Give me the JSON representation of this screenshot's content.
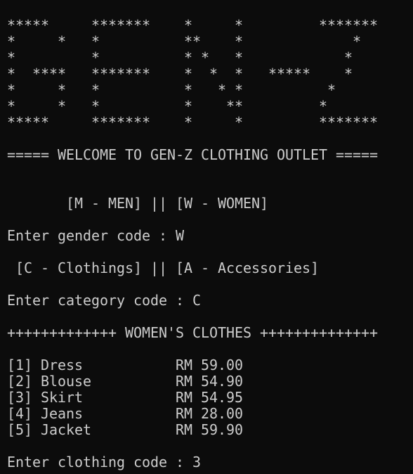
{
  "terminal": {
    "banner": [
      "*****     *******    *     *         *******",
      "*     *   *          **    *             *",
      "*         *          * *   *            *",
      "*  ****   *******    *  *  *   *****    *",
      "*     *   *          *   * *          *",
      "*     *   *          *    **         *",
      "*****     *******    *     *         *******"
    ],
    "welcome": "===== WELCOME TO GEN-Z CLOTHING OUTLET =====",
    "gender_menu": "       [M - MEN] || [W - WOMEN]",
    "gender_prompt": "Enter gender code : W",
    "category_menu": " [C - Clothings] || [A - Accessories]",
    "category_prompt": "Enter category code : C",
    "section_title": "+++++++++++++ WOMEN'S CLOTHES ++++++++++++++",
    "items": [
      "[1] Dress           RM 59.00",
      "[2] Blouse          RM 54.90",
      "[3] Skirt           RM 54.95",
      "[4] Jeans           RM 28.00",
      "[5] Jacket          RM 59.90"
    ],
    "clothing_prompt": "Enter clothing code : 3"
  }
}
